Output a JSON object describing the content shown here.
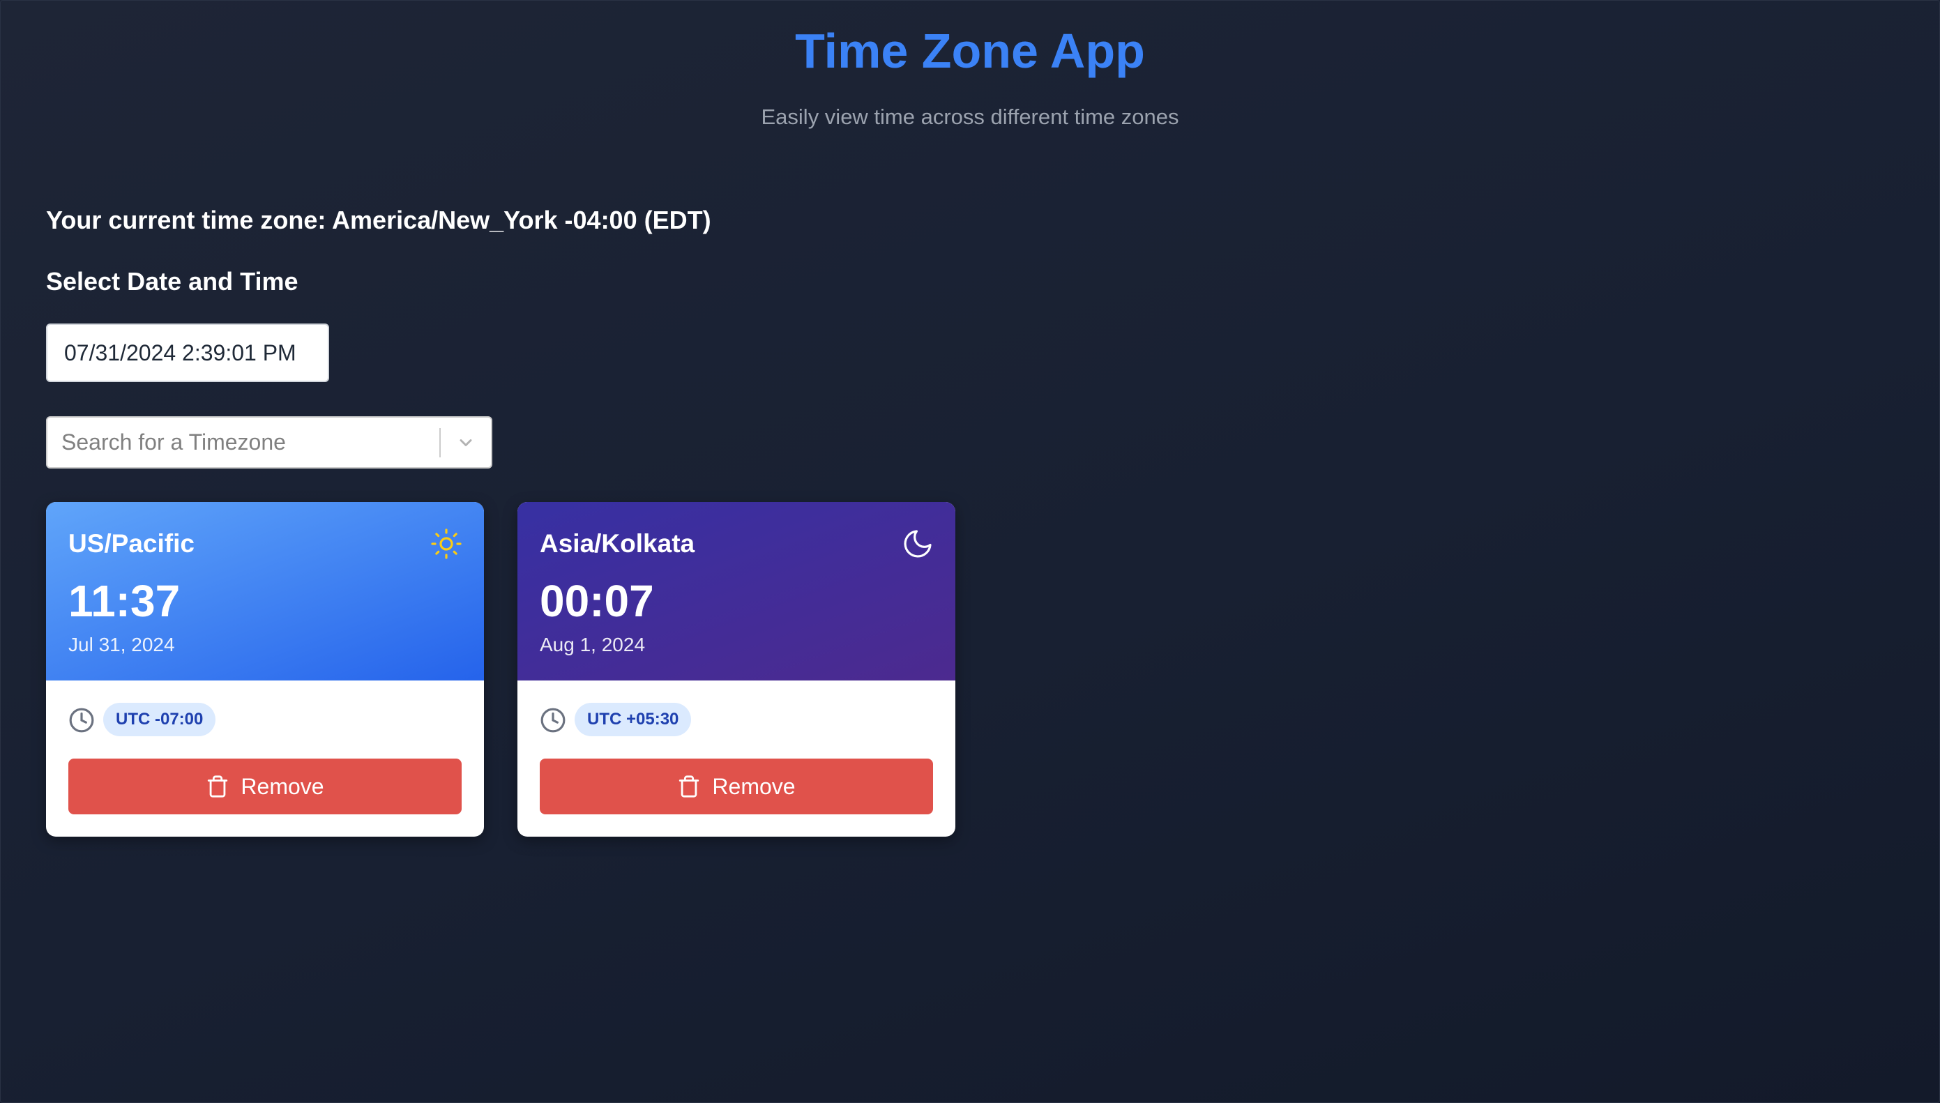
{
  "header": {
    "title": "Time Zone App",
    "subtitle": "Easily view time across different time zones"
  },
  "current_timezone": "Your current time zone: America/New_York -04:00 (EDT)",
  "date_picker": {
    "label": "Select Date and Time",
    "value": "07/31/2024 2:39:01 PM"
  },
  "timezone_search": {
    "placeholder": "Search for a Timezone",
    "dropdown_icon": "chevron-down-icon"
  },
  "cards": [
    {
      "zone": "US/Pacific",
      "time": "11:37",
      "date": "Jul 31, 2024",
      "period_icon": "sun-icon",
      "utc_offset": "UTC -07:00",
      "remove_label": "Remove",
      "header_colors": [
        "#60a5fa",
        "#2563eb"
      ]
    },
    {
      "zone": "Asia/Kolkata",
      "time": "00:07",
      "date": "Aug 1, 2024",
      "period_icon": "moon-icon",
      "utc_offset": "UTC +05:30",
      "remove_label": "Remove",
      "header_colors": [
        "#3730a3",
        "#4c2a8f"
      ]
    }
  ],
  "colors": {
    "accent": "#3b82f6",
    "remove_button": "#e0524b",
    "badge_bg": "#dbeafe",
    "badge_text": "#1e40af",
    "sun": "#facc15"
  }
}
